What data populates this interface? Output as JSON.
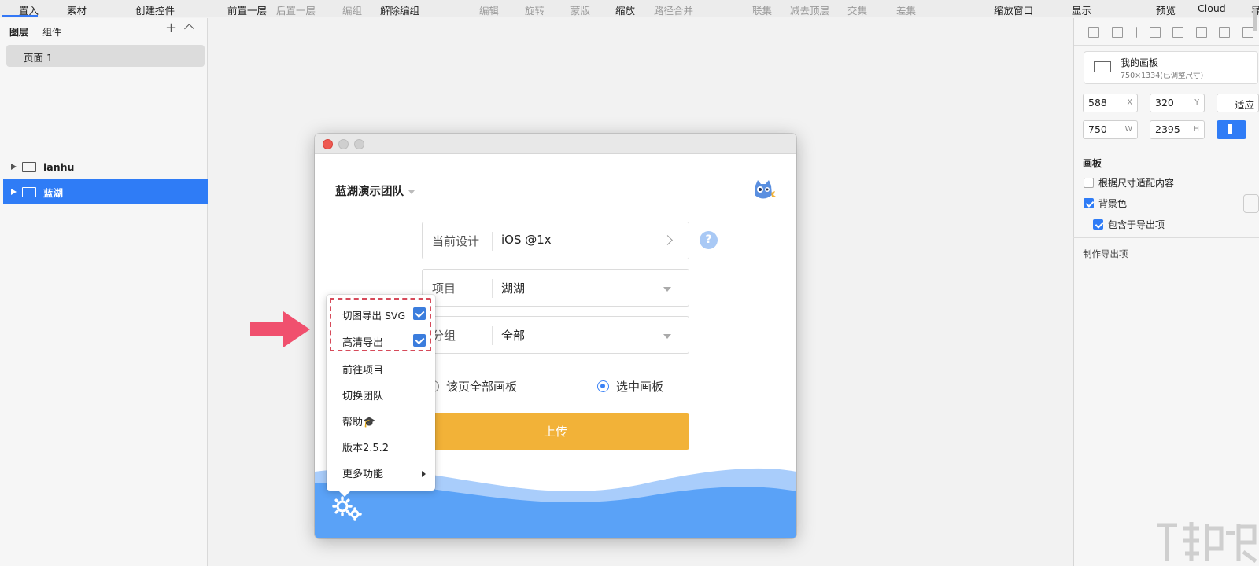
{
  "toolbar": {
    "items": [
      "置入",
      "素材",
      "创建控件",
      "前置一层",
      "后置一层",
      "编组",
      "解除编组",
      "编辑",
      "旋转",
      "蒙版",
      "缩放",
      "路径合并",
      "联集",
      "减去顶层",
      "交集",
      "差集",
      "缩放窗口",
      "显示",
      "预览",
      "Cloud",
      "导"
    ]
  },
  "sidebar": {
    "tab_layers": "图层",
    "tab_components": "组件",
    "plus": "+",
    "page": "页面 1",
    "layers": [
      {
        "label": "lanhu",
        "selected": false
      },
      {
        "label": "蓝湖",
        "selected": true
      }
    ]
  },
  "inspector": {
    "artboard_name": "我的画板",
    "artboard_sub": "750×1334(已调整尺寸)",
    "x": "588",
    "x_label": "X",
    "y": "320",
    "y_label": "Y",
    "w": "750",
    "w_label": "W",
    "h": "2395",
    "h_label": "H",
    "fit_label": "适应",
    "section_title": "画板",
    "fit_content": "根据尺寸适配内容",
    "fit_content_checked": false,
    "bg_color": "背景色",
    "bg_color_checked": true,
    "include_export": "包含于导出项",
    "include_export_checked": true,
    "make_export": "制作导出项"
  },
  "plugin": {
    "team_name": "蓝湖演示团队",
    "current_design_label": "当前设计",
    "current_design_value": "iOS @1x",
    "help": "?",
    "project_label": "项目",
    "project_value": "湖湖",
    "group_label": "分组",
    "group_value": "全部",
    "radio_all": "该页全部画板",
    "radio_selected": "选中画板",
    "radio_selected_on": true,
    "upload": "上传",
    "accent_color": "#f2b238",
    "wave_color": "#5aa2f7"
  },
  "menu": {
    "svg_export": "切图导出 SVG",
    "svg_export_checked": true,
    "hd_export": "高清导出",
    "hd_export_checked": true,
    "goto_project": "前往项目",
    "switch_team": "切换团队",
    "help": "帮助",
    "help_emoji": "🎓",
    "version": "版本2.5.2",
    "more": "更多功能"
  },
  "annotation": {
    "arrow_color": "#f0506e",
    "dashed_box_color": "#d64a5a"
  },
  "watermark": {
    "icon": "watermark-logo"
  }
}
